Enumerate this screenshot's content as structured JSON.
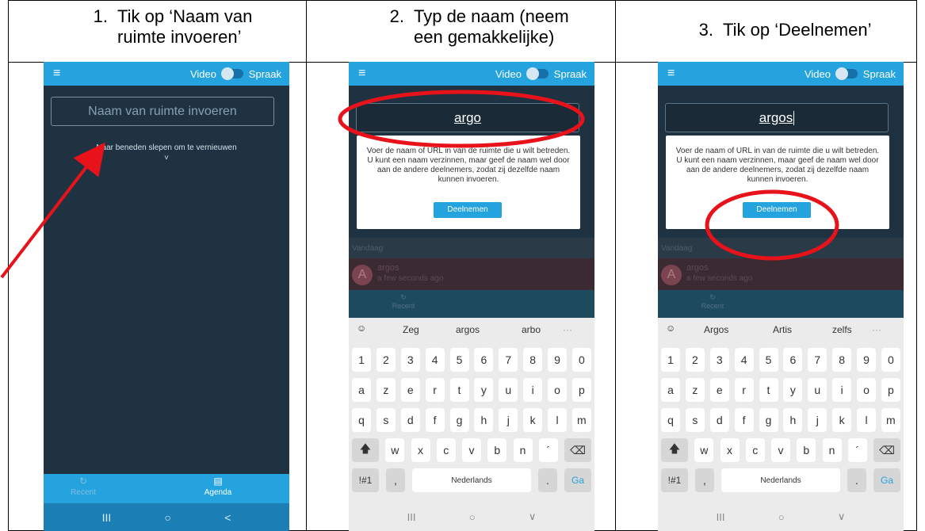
{
  "steps": [
    {
      "num": "1.",
      "line1": "Tik op ‘Naam van",
      "line2": "ruimte invoeren’"
    },
    {
      "num": "2.",
      "line1": "Typ de naam (neem",
      "line2": "een gemakkelijke)"
    },
    {
      "num": "3.",
      "line1": "Tik op ‘Deelnemen’",
      "line2": ""
    }
  ],
  "app": {
    "menu_icon": "menu-icon",
    "video_label": "Video",
    "spraak_label": "Spraak",
    "room_placeholder": "Naam van ruimte invoeren",
    "pull_text": "Naar beneden slepen om te vernieuwen",
    "chevron": "˅",
    "tab_recent": "Recent",
    "tab_agenda": "Agenda",
    "dialog_text": "Voer de naam of URL in van de ruimte die u wilt betreden. U kunt een naam verzinnen, maar geef de naam wel door aan de andere deelnemers, zodat zij dezelfde naam kunnen invoeren.",
    "join_label": "Deelnemen",
    "today_label": "Vandaag",
    "recent_room": "argos",
    "recent_time": "a few seconds ago",
    "avatar_letter": "A"
  },
  "screen2": {
    "input_value": "argo",
    "suggestions": [
      "Zeg",
      "argos",
      "arbo"
    ]
  },
  "screen3": {
    "input_value": "argos",
    "suggestions": [
      "Argos",
      "Artis",
      "zelfs"
    ]
  },
  "keyboard": {
    "row_digits": [
      "1",
      "2",
      "3",
      "4",
      "5",
      "6",
      "7",
      "8",
      "9",
      "0"
    ],
    "row1": [
      "a",
      "z",
      "e",
      "r",
      "t",
      "y",
      "u",
      "i",
      "o",
      "p"
    ],
    "row2": [
      "q",
      "s",
      "d",
      "f",
      "g",
      "h",
      "j",
      "k",
      "l",
      "m"
    ],
    "row3": [
      "w",
      "x",
      "c",
      "v",
      "b",
      "n",
      "´"
    ],
    "sym_label": "!#1",
    "comma": ",",
    "space_label": "Nederlands",
    "period": ".",
    "go_label": "Ga",
    "more": "···"
  },
  "nav": {
    "recents": "III",
    "home": "○",
    "back1": "<",
    "back2": "∨"
  },
  "colors": {
    "accent": "#24a3de",
    "annotation": "#e8121b",
    "dark_bg": "#1e3242"
  }
}
